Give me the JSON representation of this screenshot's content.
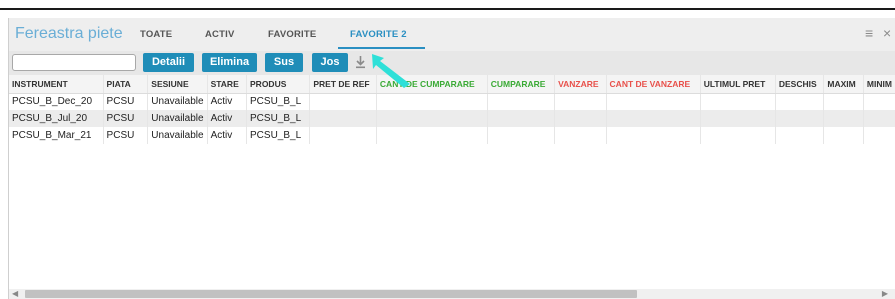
{
  "window": {
    "title": "Fereastra piete",
    "tabs": [
      {
        "label": "TOATE",
        "active": false
      },
      {
        "label": "ACTIV",
        "active": false
      },
      {
        "label": "FAVORITE",
        "active": false
      },
      {
        "label": "FAVORITE 2",
        "active": true
      }
    ],
    "menu_icon": "hamburger-menu-icon",
    "close_icon": "close-icon"
  },
  "toolbar": {
    "search_value": "",
    "buttons": {
      "details": "Detalii",
      "remove": "Elimina",
      "up": "Sus",
      "down": "Jos"
    },
    "download_icon": "download-icon"
  },
  "grid": {
    "columns": [
      {
        "label": "INSTRUMENT",
        "color": "default"
      },
      {
        "label": "PIATA",
        "color": "default"
      },
      {
        "label": "SESIUNE",
        "color": "default"
      },
      {
        "label": "STARE",
        "color": "default"
      },
      {
        "label": "PRODUS",
        "color": "default"
      },
      {
        "label": "PRET DE REF",
        "color": "default"
      },
      {
        "label": "CANT DE CUMPARARE",
        "color": "green"
      },
      {
        "label": "CUMPARARE",
        "color": "green"
      },
      {
        "label": "VANZARE",
        "color": "red"
      },
      {
        "label": "CANT DE VANZARE",
        "color": "red"
      },
      {
        "label": "ULTIMUL PRET",
        "color": "default"
      },
      {
        "label": "DESCHIS",
        "color": "default"
      },
      {
        "label": "MAXIM",
        "color": "default"
      },
      {
        "label": "MINIM",
        "color": "default"
      }
    ],
    "rows": [
      [
        "PCSU_B_Dec_20",
        "PCSU",
        "Unavailable",
        "Activ",
        "PCSU_B_L",
        "",
        "",
        "",
        "",
        "",
        "",
        "",
        "",
        ""
      ],
      [
        "PCSU_B_Jul_20",
        "PCSU",
        "Unavailable",
        "Activ",
        "PCSU_B_L",
        "",
        "",
        "",
        "",
        "",
        "",
        "",
        "",
        ""
      ],
      [
        "PCSU_B_Mar_21",
        "PCSU",
        "Unavailable",
        "Activ",
        "PCSU_B_L",
        "",
        "",
        "",
        "",
        "",
        "",
        "",
        "",
        ""
      ]
    ]
  },
  "colors": {
    "accent": "#2a8fc2",
    "button": "#1f8db8",
    "title": "#6aaed6",
    "buy_header": "#3aaa35",
    "sell_header": "#e8504a",
    "pointer": "#2ee0d8"
  }
}
